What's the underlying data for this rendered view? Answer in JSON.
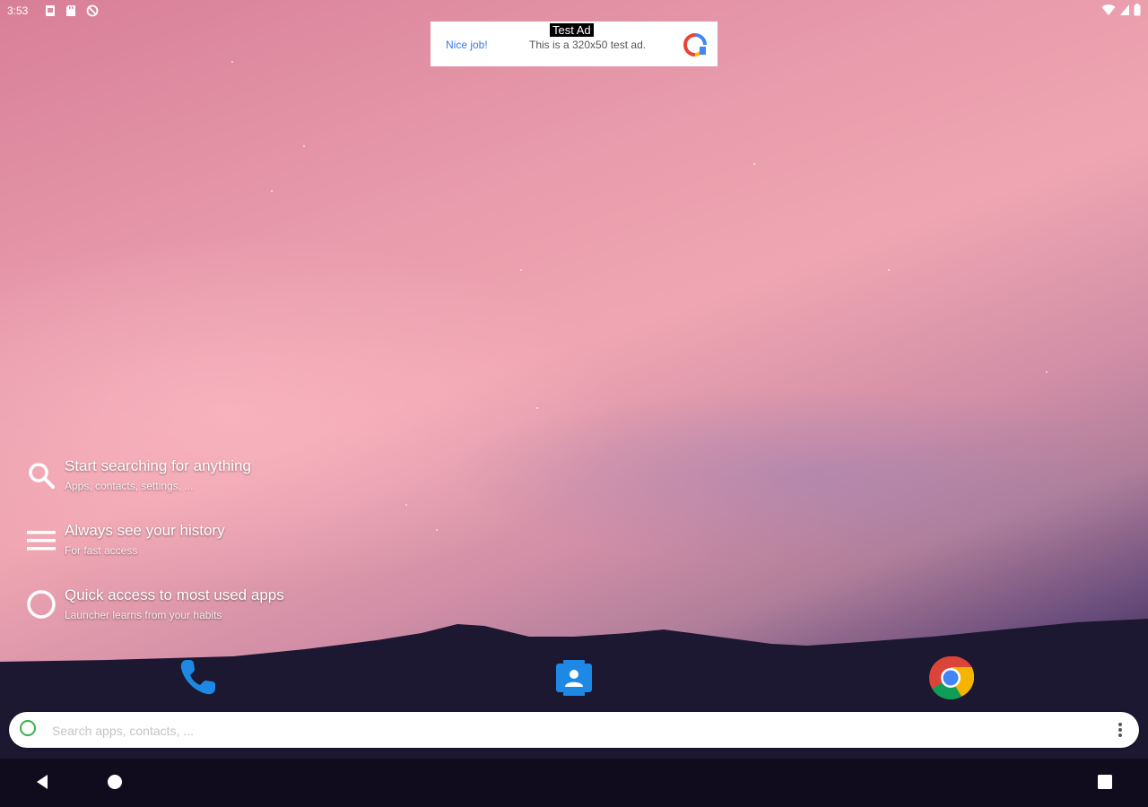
{
  "status_bar": {
    "time": "3:53",
    "left_icons": [
      "sim-card-icon",
      "storage-card-icon",
      "no-sync-icon"
    ],
    "right_icons": [
      "wifi-icon",
      "signal-icon",
      "battery-icon"
    ]
  },
  "ad_banner": {
    "label": "Test Ad",
    "nice_job": "Nice job!",
    "text": "This is a 320x50 test ad."
  },
  "tips": [
    {
      "icon": "search-icon",
      "title": "Start searching for anything",
      "subtitle": "Apps, contacts, settings, ..."
    },
    {
      "icon": "history-list-icon",
      "title": "Always see your history",
      "subtitle": "For fast access"
    },
    {
      "icon": "circle-icon",
      "title": "Quick access to most used apps",
      "subtitle": "Launcher learns from your habits"
    }
  ],
  "dock": {
    "apps": [
      "phone-icon",
      "contacts-icon",
      "chrome-icon"
    ]
  },
  "search": {
    "placeholder": "Search apps, contacts, ..."
  },
  "nav_bar": {
    "buttons": [
      "back",
      "home",
      "recents"
    ]
  },
  "colors": {
    "search_ring": "#3bb04b",
    "ad_link": "#3b78e7",
    "phone_blue": "#1e88e5",
    "contacts_blue": "#1e88e5",
    "nav_bg": "#100c1e"
  }
}
